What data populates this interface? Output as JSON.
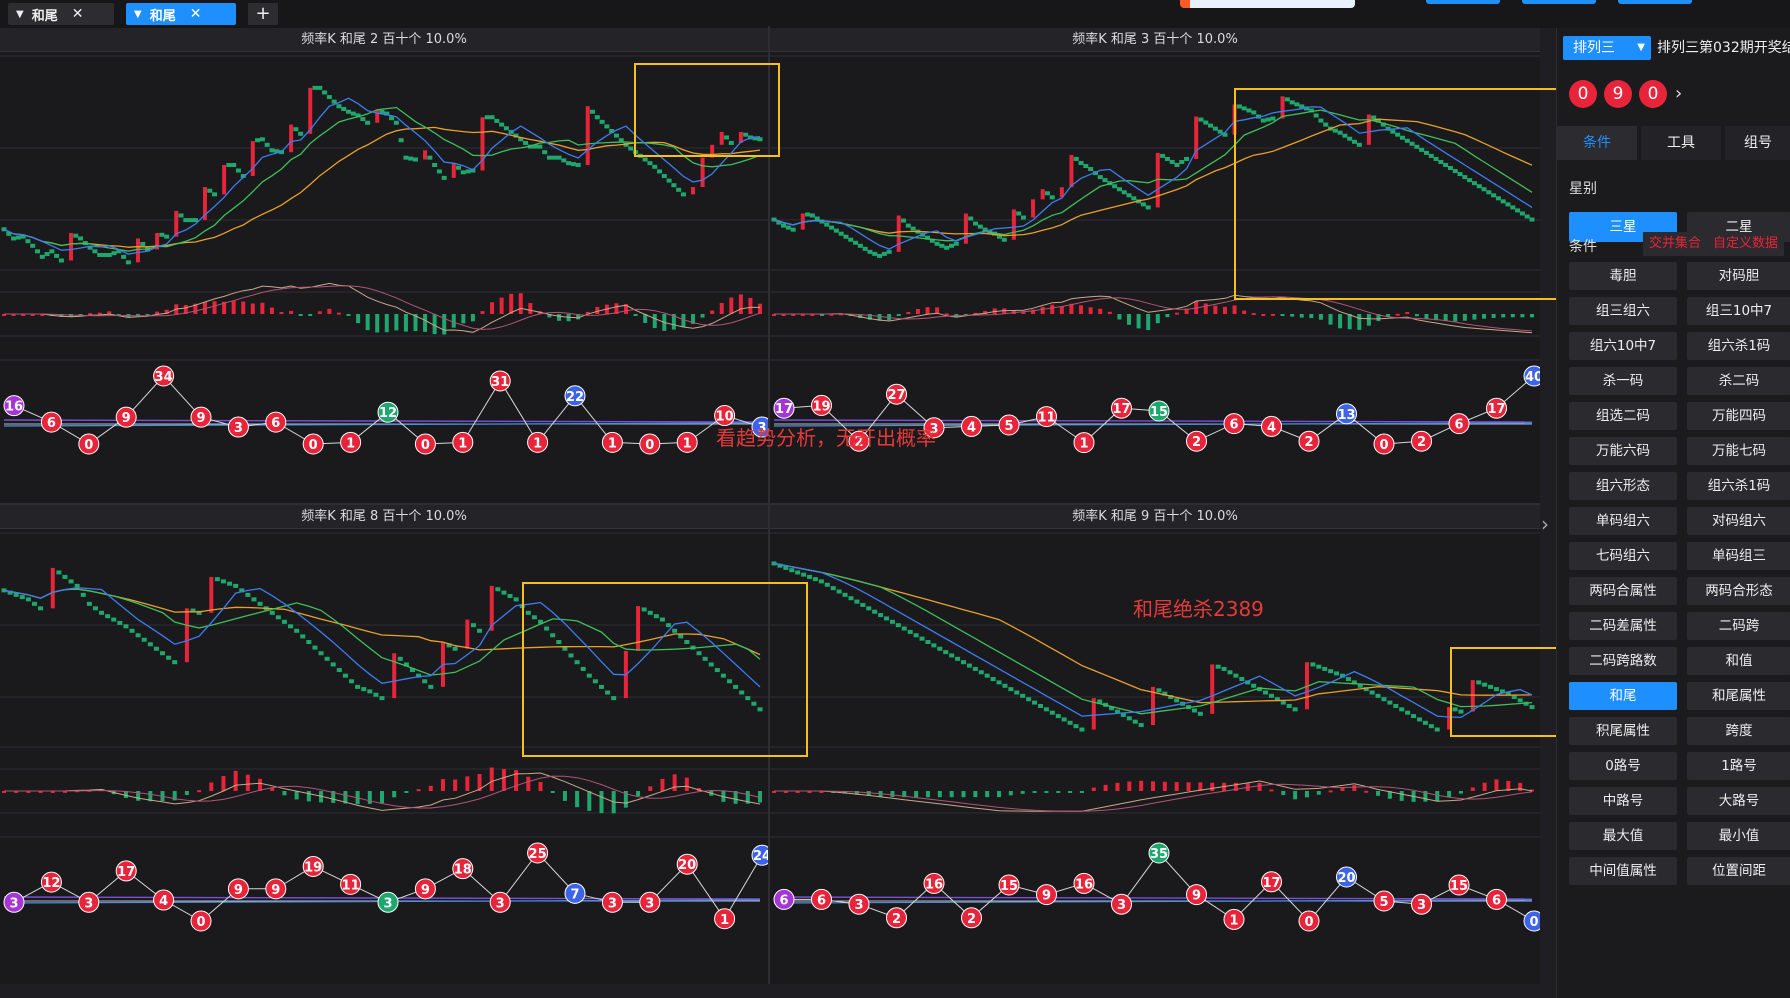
{
  "tabs": [
    {
      "label": "和尾"
    },
    {
      "label": "和尾"
    }
  ],
  "add_tab": "+",
  "colors": {
    "up": "#e8243a",
    "down": "#1fa86e",
    "accent": "#1e8fff",
    "highlight": "#f3c11a",
    "ma5": "#3d7cf0",
    "ma10": "#3fbe5a",
    "ma20": "#e9a02b"
  },
  "charts": [
    {
      "title": "频率K  和尾  2  百十个  10.0%",
      "balls": [
        [
          16,
          "p"
        ],
        [
          6,
          "r"
        ],
        [
          0,
          "r"
        ],
        [
          9,
          "r"
        ],
        [
          34,
          "r"
        ],
        [
          9,
          "r"
        ],
        [
          3,
          "r"
        ],
        [
          6,
          "r"
        ],
        [
          0,
          "r"
        ],
        [
          1,
          "r"
        ],
        [
          12,
          "g"
        ],
        [
          0,
          "r"
        ],
        [
          1,
          "r"
        ],
        [
          31,
          "r"
        ],
        [
          1,
          "r"
        ],
        [
          22,
          "b"
        ],
        [
          1,
          "r"
        ],
        [
          0,
          "r"
        ],
        [
          1,
          "r"
        ],
        [
          10,
          "r"
        ],
        [
          3,
          "b"
        ]
      ],
      "close": [
        50,
        45,
        46,
        41,
        35,
        38,
        33,
        48,
        45,
        40,
        36,
        36,
        38,
        32,
        45,
        39,
        48,
        46,
        60,
        55,
        55,
        73,
        69,
        85,
        85,
        79,
        98,
        99,
        93,
        92,
        107,
        102,
        127,
        127,
        122,
        117,
        114,
        112,
        108,
        115,
        113,
        108,
        89,
        88,
        93,
        85,
        78,
        86,
        81,
        82,
        111,
        111,
        107,
        103,
        99,
        95,
        95,
        89,
        89,
        86,
        85,
        117,
        111,
        106,
        101,
        96,
        92,
        88,
        84,
        79,
        74,
        69,
        73,
        89,
        96,
        103,
        97,
        103,
        100,
        99
      ],
      "ymin": 30,
      "ymax": 140
    },
    {
      "title": "频率K  和尾  3  百十个  10.0%",
      "balls": [
        [
          17,
          "p"
        ],
        [
          19,
          "r"
        ],
        [
          2,
          "r"
        ],
        [
          27,
          "r"
        ],
        [
          3,
          "r"
        ],
        [
          4,
          "r"
        ],
        [
          5,
          "r"
        ],
        [
          11,
          "r"
        ],
        [
          1,
          "r"
        ],
        [
          17,
          "r"
        ],
        [
          15,
          "g"
        ],
        [
          2,
          "r"
        ],
        [
          6,
          "r"
        ],
        [
          4,
          "r"
        ],
        [
          2,
          "r"
        ],
        [
          13,
          "b"
        ],
        [
          0,
          "r"
        ],
        [
          2,
          "r"
        ],
        [
          6,
          "r"
        ],
        [
          17,
          "r"
        ],
        [
          40,
          "b"
        ]
      ],
      "close": [
        63,
        60,
        58,
        66,
        65,
        62,
        59,
        56,
        53,
        50,
        47,
        45,
        47,
        65,
        60,
        57,
        54,
        51,
        49,
        51,
        66,
        61,
        58,
        56,
        53,
        68,
        64,
        73,
        78,
        74,
        79,
        95,
        91,
        88,
        84,
        81,
        78,
        75,
        72,
        69,
        96,
        93,
        90,
        93,
        114,
        111,
        108,
        105,
        120,
        118,
        116,
        112,
        113,
        124,
        121,
        119,
        117,
        112,
        108,
        106,
        103,
        100,
        115,
        112,
        108,
        105,
        102,
        99,
        96,
        93,
        90,
        87,
        84,
        81,
        78,
        75,
        72,
        69,
        66,
        63
      ],
      "ymin": 40,
      "ymax": 140
    },
    {
      "title": "频率K  和尾  8  百十个  10.0%",
      "balls": [
        [
          3,
          "p"
        ],
        [
          12,
          "r"
        ],
        [
          3,
          "r"
        ],
        [
          17,
          "r"
        ],
        [
          4,
          "r"
        ],
        [
          0,
          "r"
        ],
        [
          9,
          "r"
        ],
        [
          9,
          "r"
        ],
        [
          19,
          "r"
        ],
        [
          11,
          "r"
        ],
        [
          3,
          "g"
        ],
        [
          9,
          "r"
        ],
        [
          18,
          "r"
        ],
        [
          3,
          "r"
        ],
        [
          25,
          "r"
        ],
        [
          7,
          "b"
        ],
        [
          3,
          "r"
        ],
        [
          3,
          "r"
        ],
        [
          20,
          "r"
        ],
        [
          1,
          "r"
        ],
        [
          24,
          "b"
        ]
      ],
      "close": [
        118,
        116,
        114,
        110,
        128,
        124,
        120,
        112,
        108,
        105,
        102,
        98,
        94,
        90,
        86,
        110,
        108,
        124,
        122,
        120,
        116,
        112,
        108,
        104,
        100,
        95,
        90,
        85,
        80,
        75,
        73,
        70,
        90,
        85,
        80,
        75,
        95,
        92,
        105,
        100,
        120,
        117,
        114,
        108,
        104,
        98,
        92,
        86,
        80,
        75,
        70,
        91,
        111,
        108,
        105,
        100,
        95,
        90,
        85,
        80,
        75,
        70,
        65
      ],
      "ymin": 50,
      "ymax": 140
    },
    {
      "title": "频率K  和尾  9  百十个  10.0%",
      "balls": [
        [
          6,
          "p"
        ],
        [
          6,
          "r"
        ],
        [
          3,
          "r"
        ],
        [
          2,
          "r"
        ],
        [
          16,
          "r"
        ],
        [
          2,
          "r"
        ],
        [
          15,
          "r"
        ],
        [
          9,
          "r"
        ],
        [
          16,
          "r"
        ],
        [
          3,
          "r"
        ],
        [
          35,
          "g"
        ],
        [
          9,
          "r"
        ],
        [
          1,
          "r"
        ],
        [
          17,
          "r"
        ],
        [
          0,
          "r"
        ],
        [
          20,
          "b"
        ],
        [
          5,
          "r"
        ],
        [
          3,
          "r"
        ],
        [
          15,
          "r"
        ],
        [
          6,
          "r"
        ],
        [
          0,
          "b"
        ]
      ],
      "close": [
        130,
        128,
        126,
        124,
        122,
        119,
        116,
        113,
        110,
        107,
        104,
        101,
        98,
        95,
        92,
        89,
        86,
        83,
        80,
        77,
        74,
        71,
        68,
        65,
        62,
        59,
        56,
        70,
        67,
        64,
        61,
        58,
        75,
        72,
        69,
        66,
        63,
        85,
        83,
        80,
        77,
        74,
        71,
        68,
        65,
        86,
        84,
        82,
        80,
        77,
        74,
        71,
        68,
        65,
        62,
        59,
        56,
        66,
        64,
        78,
        76,
        74,
        72,
        69,
        66
      ],
      "ymin": 50,
      "ymax": 140
    }
  ],
  "annotations": {
    "trend_note": "看趋势分析，无开出概率",
    "kill_note": "和尾绝杀2389"
  },
  "side": {
    "lottery": "排列三",
    "issue": "排列三第032期开奖结",
    "balls": [
      "0",
      "9",
      "0"
    ],
    "tabs": [
      "条件",
      "工具",
      "组号"
    ],
    "star_label": "星别",
    "star_options": [
      "三星",
      "二星"
    ],
    "cond_label": "条件",
    "chips": [
      "交并集合",
      "自定义数据"
    ],
    "buttons": [
      "毒胆",
      "对码胆",
      "组三组六",
      "组三10中7",
      "组六10中7",
      "组六杀1码",
      "杀一码",
      "杀二码",
      "组选二码",
      "万能四码",
      "万能六码",
      "万能七码",
      "组六形态",
      "组六杀1码",
      "单码组六",
      "对码组六",
      "七码组六",
      "单码组三",
      "两码合属性",
      "两码合形态",
      "二码差属性",
      "二码跨",
      "二码跨路数",
      "和值",
      "和尾",
      "和尾属性",
      "积尾属性",
      "跨度",
      "0路号",
      "1路号",
      "中路号",
      "大路号",
      "最大值",
      "最小值",
      "中间值属性",
      "位置间距"
    ]
  }
}
